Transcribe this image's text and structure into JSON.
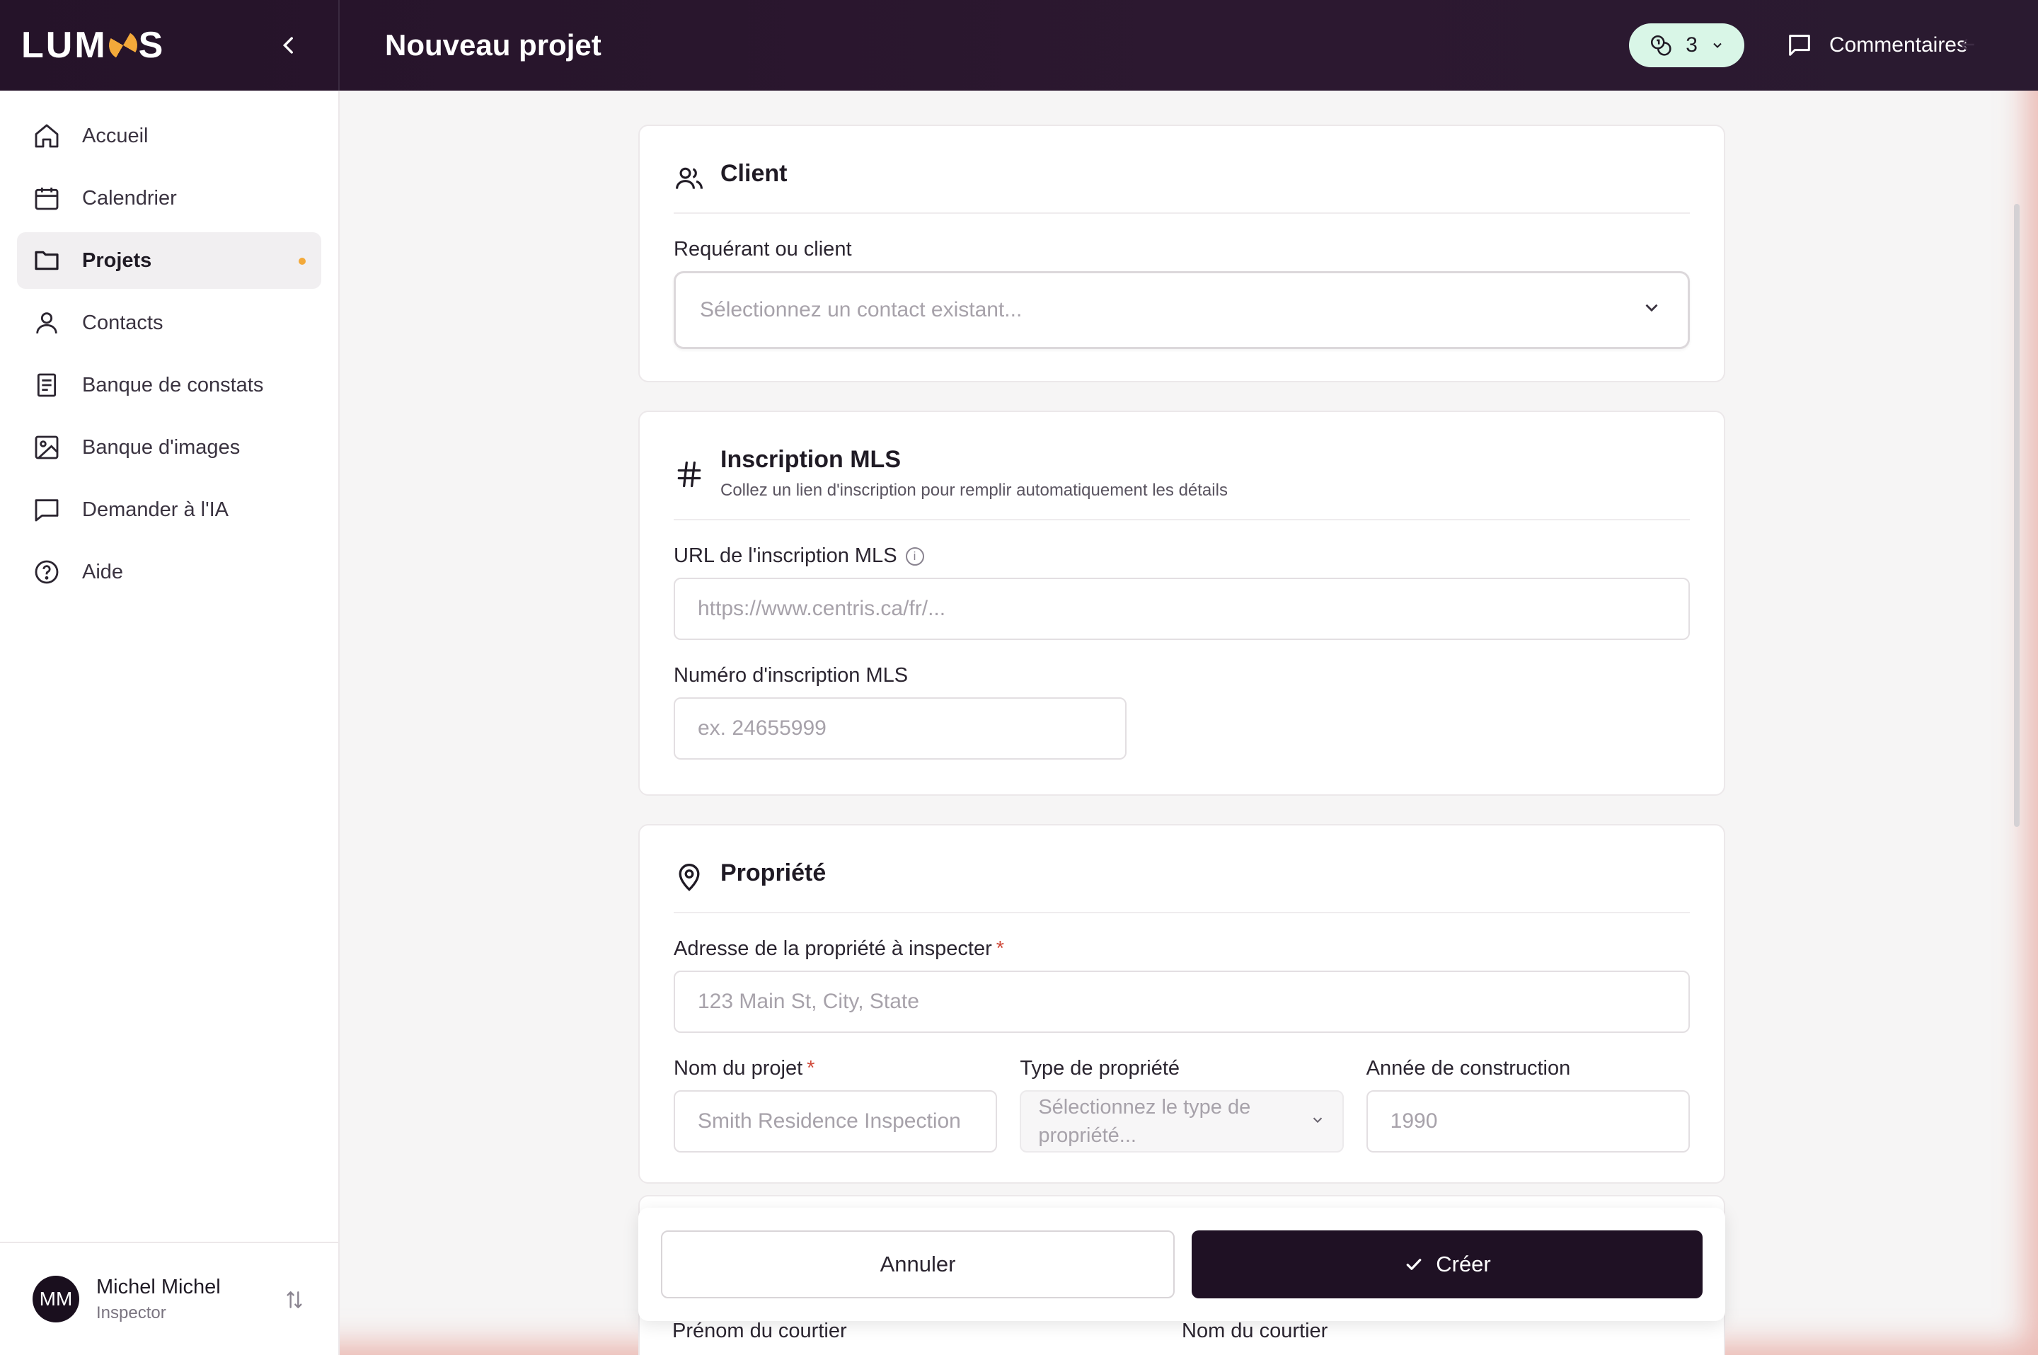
{
  "brand": {
    "logo_left": "LUM",
    "logo_right": "S"
  },
  "header": {
    "title": "Nouveau projet",
    "credits_count": "3",
    "comments_label": "Commentaires"
  },
  "sidebar": {
    "items": [
      {
        "label": "Accueil",
        "icon": "home-icon"
      },
      {
        "label": "Calendrier",
        "icon": "calendar-icon"
      },
      {
        "label": "Projets",
        "icon": "folder-icon",
        "active": true
      },
      {
        "label": "Contacts",
        "icon": "user-icon"
      },
      {
        "label": "Banque de constats",
        "icon": "document-icon"
      },
      {
        "label": "Banque d'images",
        "icon": "image-icon"
      },
      {
        "label": "Demander à l'IA",
        "icon": "chat-icon"
      },
      {
        "label": "Aide",
        "icon": "help-icon"
      }
    ],
    "user": {
      "initials": "MM",
      "name": "Michel Michel",
      "role": "Inspector"
    }
  },
  "client_card": {
    "title": "Client",
    "field_label": "Requérant ou client",
    "placeholder": "Sélectionnez un contact existant..."
  },
  "mls_card": {
    "title": "Inscription MLS",
    "subtitle": "Collez un lien d'inscription pour remplir automatiquement les détails",
    "url_label": "URL de l'inscription MLS",
    "url_placeholder": "https://www.centris.ca/fr/...",
    "number_label": "Numéro d'inscription MLS",
    "number_placeholder": "ex. 24655999"
  },
  "property_card": {
    "title": "Propriété",
    "address_label": "Adresse de la propriété à inspecter",
    "address_placeholder": "123 Main St, City, State",
    "project_name_label": "Nom du projet",
    "project_name_placeholder": "Smith Residence Inspection",
    "type_label": "Type de propriété",
    "type_placeholder": "Sélectionnez le type de propriété...",
    "year_label": "Année de construction",
    "year_placeholder": "1990",
    "required_mark": "*"
  },
  "actions": {
    "cancel": "Annuler",
    "create": "Créer"
  },
  "broker": {
    "first_name_label": "Prénom du courtier",
    "last_name_label": "Nom du courtier"
  },
  "colors": {
    "header_bg": "#251329",
    "accent": "#f3a93a",
    "primary_button": "#1f1124",
    "credits_bg": "#d9f6e7"
  }
}
